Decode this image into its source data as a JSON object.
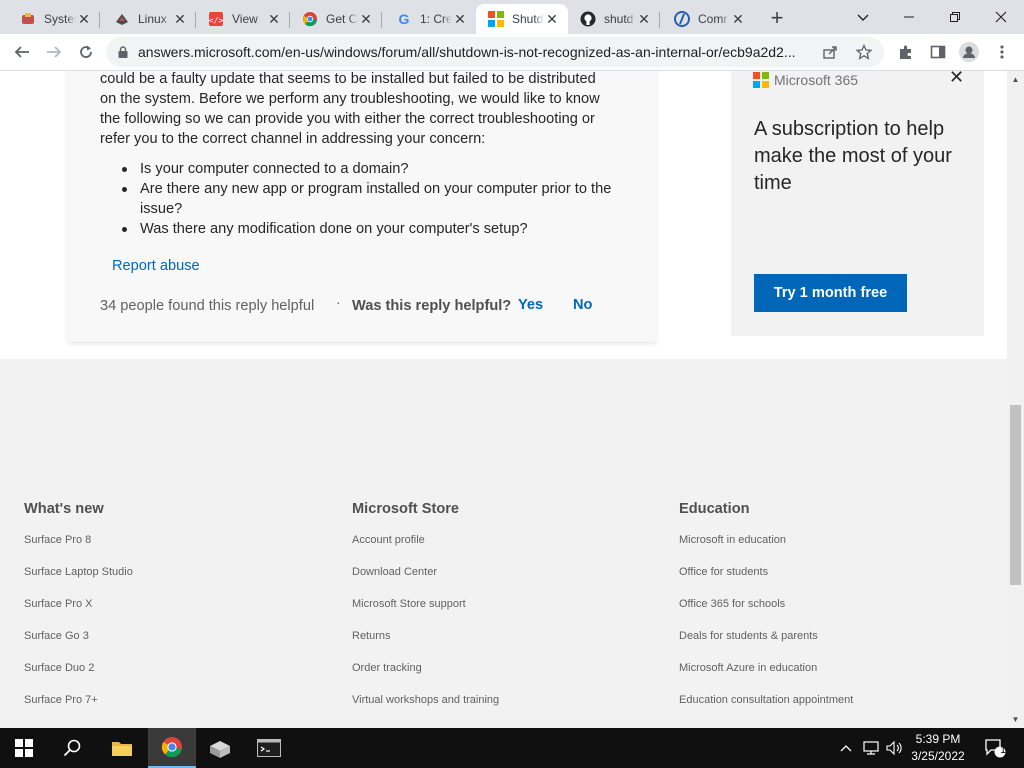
{
  "browser": {
    "tabs": [
      {
        "title": "System",
        "icon": "app-icon"
      },
      {
        "title": "Linux",
        "icon": "app-icon"
      },
      {
        "title": "View",
        "icon": "code-icon"
      },
      {
        "title": "Get C",
        "icon": "chrome-icon"
      },
      {
        "title": "1: Cre",
        "icon": "google-icon"
      },
      {
        "title": "Shutd",
        "icon": "microsoft-icon"
      },
      {
        "title": "shutd",
        "icon": "github-icon"
      },
      {
        "title": "Comr",
        "icon": "app-icon"
      }
    ],
    "active_tab_index": 5,
    "url": "answers.microsoft.com/en-us/windows/forum/all/shutdown-is-not-recognized-as-an-internal-or/ecb9a2d2..."
  },
  "reply": {
    "paragraph_lines": [
      "could be a faulty update that seems to be installed but failed to be distributed",
      "on the system. Before we perform any troubleshooting, we would like to know",
      "the following so we can provide you with either the correct troubleshooting or",
      "refer you to the correct channel in addressing your concern:"
    ],
    "questions": [
      "Is your computer connected to a domain?",
      "Are there any new app or program installed on your computer prior to the issue?",
      "Was there any modification done on your computer's setup?"
    ],
    "report_abuse": "Report abuse",
    "helpful_count": "34 people found this reply helpful",
    "separator": "·",
    "helpful_question": "Was this reply helpful?",
    "yes": "Yes",
    "no": "No"
  },
  "ad": {
    "brand": "Microsoft 365",
    "close": "✕",
    "headline": "A subscription to help make the most of your time",
    "cta": "Try 1 month free",
    "brand_colors": [
      "#f25022",
      "#7fba00",
      "#00a4ef",
      "#ffb900"
    ],
    "accent": "#0067b8"
  },
  "footer": {
    "columns": [
      {
        "heading": "What's new",
        "links": [
          "Surface Pro 8",
          "Surface Laptop Studio",
          "Surface Pro X",
          "Surface Go 3",
          "Surface Duo 2",
          "Surface Pro 7+"
        ]
      },
      {
        "heading": "Microsoft Store",
        "links": [
          "Account profile",
          "Download Center",
          "Microsoft Store support",
          "Returns",
          "Order tracking",
          "Virtual workshops and training"
        ]
      },
      {
        "heading": "Education",
        "links": [
          "Microsoft in education",
          "Office for students",
          "Office 365 for schools",
          "Deals for students & parents",
          "Microsoft Azure in education",
          "Education consultation appointment"
        ]
      }
    ]
  },
  "taskbar": {
    "time": "5:39 PM",
    "date": "3/25/2022",
    "notification_count": "1"
  }
}
